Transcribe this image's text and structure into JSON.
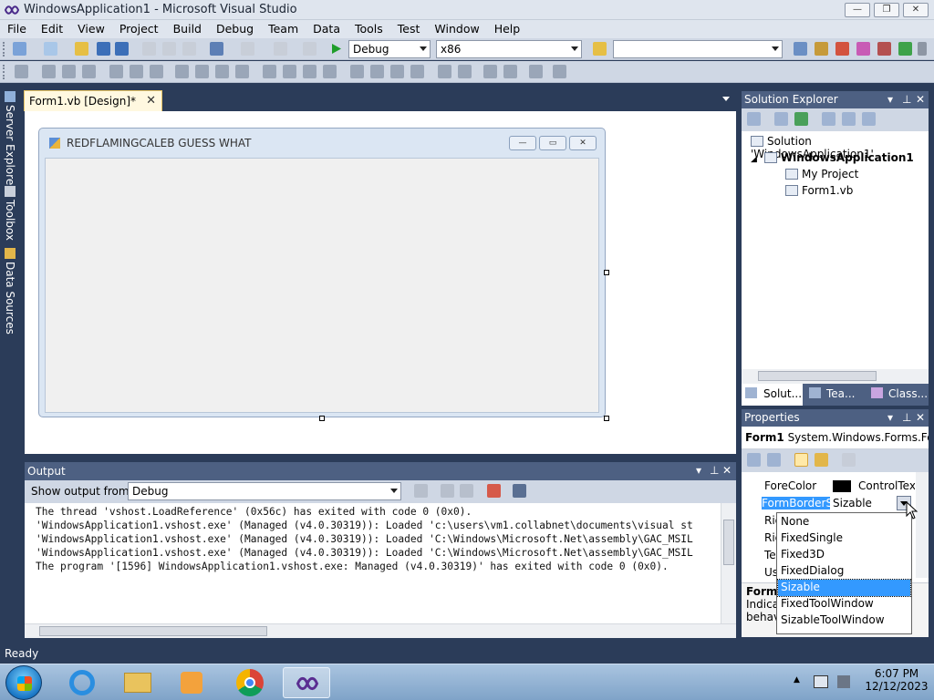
{
  "window": {
    "title": "WindowsApplication1 - Microsoft Visual Studio",
    "minimize": "—",
    "restore": "❐",
    "close": "✕"
  },
  "menu": [
    "File",
    "Edit",
    "View",
    "Project",
    "Build",
    "Debug",
    "Team",
    "Data",
    "Tools",
    "Test",
    "Window",
    "Help"
  ],
  "toolbar": {
    "config_value": "Debug",
    "platform_value": "x86",
    "find_value": ""
  },
  "side_tabs": {
    "server_explorer": "Server Explorer",
    "toolbox": "Toolbox",
    "data_sources": "Data Sources"
  },
  "document_tab": {
    "label": "Form1.vb [Design]*",
    "close": "✕"
  },
  "form": {
    "title": "REDFLAMINGCALEB GUESS WHAT"
  },
  "output": {
    "title": "Output",
    "show_from_label": "Show output from:",
    "show_from_value": "Debug",
    "lines": [
      "The thread 'vshost.LoadReference' (0x56c) has exited with code 0 (0x0).",
      "'WindowsApplication1.vshost.exe' (Managed (v4.0.30319)): Loaded 'c:\\users\\vm1.collabnet\\documents\\visual st",
      "'WindowsApplication1.vshost.exe' (Managed (v4.0.30319)): Loaded 'C:\\Windows\\Microsoft.Net\\assembly\\GAC_MSIL",
      "'WindowsApplication1.vshost.exe' (Managed (v4.0.30319)): Loaded 'C:\\Windows\\Microsoft.Net\\assembly\\GAC_MSIL",
      "The program '[1596] WindowsApplication1.vshost.exe: Managed (v4.0.30319)' has exited with code 0 (0x0)."
    ]
  },
  "solution_explorer": {
    "title": "Solution Explorer",
    "solution": "Solution 'WindowsApplication1'",
    "project": "WindowsApplication1",
    "my_project": "My Project",
    "form_file": "Form1.vb",
    "tabs": [
      "Solut...",
      "Tea...",
      "Class..."
    ]
  },
  "properties": {
    "title": "Properties",
    "object_name": "Form1",
    "object_type": "System.Windows.Forms.Fo",
    "rows": [
      {
        "name": "ForeColor",
        "value": "ControlTex"
      },
      {
        "name": "FormBorderSt",
        "value": "Sizable"
      },
      {
        "name": "Rig",
        "value": ""
      },
      {
        "name": "Rig",
        "value": ""
      },
      {
        "name": "Te",
        "value": ""
      },
      {
        "name": "Us",
        "value": ""
      }
    ],
    "desc_title": "FormB",
    "desc_line1": "Indicat",
    "desc_line2": "behav"
  },
  "dropdown": {
    "options": [
      "None",
      "FixedSingle",
      "Fixed3D",
      "FixedDialog",
      "Sizable",
      "FixedToolWindow",
      "SizableToolWindow"
    ],
    "selected": "Sizable"
  },
  "status": {
    "text": "Ready"
  },
  "taskbar": {
    "time": "6:07 PM",
    "date": "12/12/2023"
  },
  "colors": {
    "accent": "#4d6082",
    "selection": "#3399ff",
    "vs_background": "#2b3c59"
  }
}
